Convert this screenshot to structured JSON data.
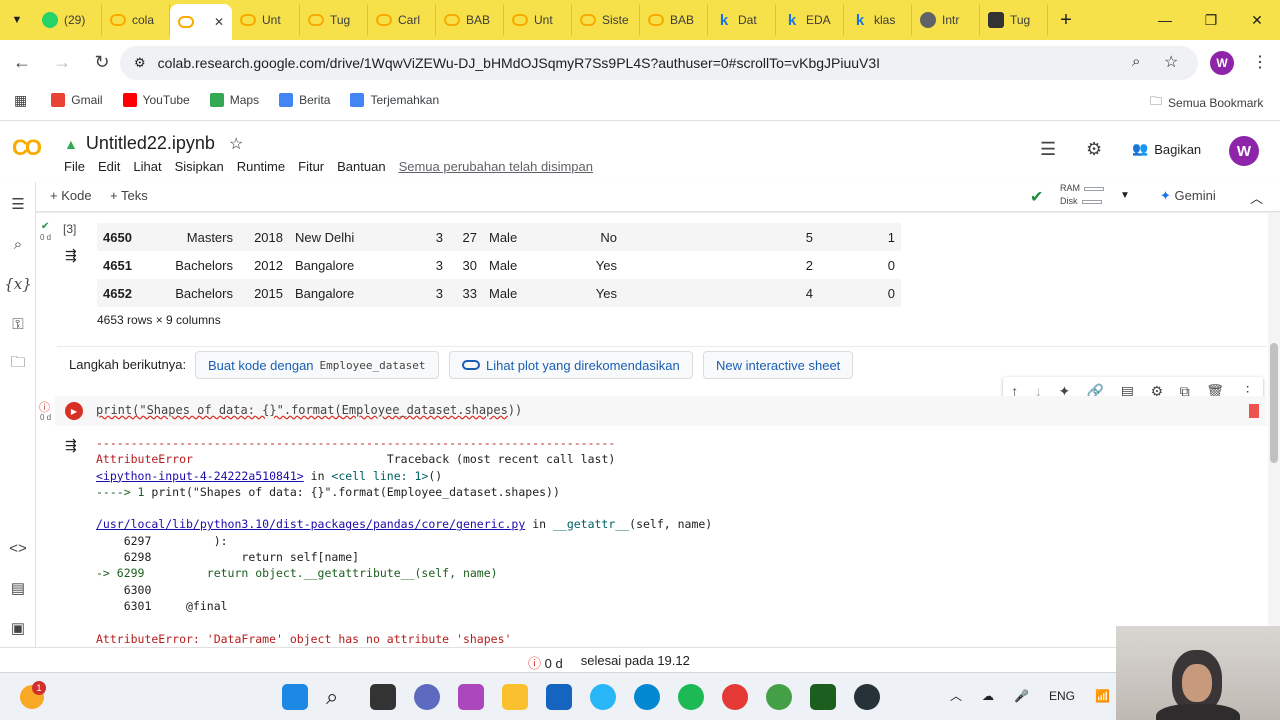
{
  "browser": {
    "tabs": [
      {
        "label": "(29)",
        "icon": "whatsapp-icon"
      },
      {
        "label": "cola",
        "icon": "colab-icon"
      },
      {
        "label": "",
        "icon": "colab-icon",
        "active": true
      },
      {
        "label": "Unt",
        "icon": "colab-icon"
      },
      {
        "label": "Tug",
        "icon": "colab-icon"
      },
      {
        "label": "Carl",
        "icon": "colab-icon"
      },
      {
        "label": "BAB",
        "icon": "colab-icon"
      },
      {
        "label": "Unt",
        "icon": "colab-icon"
      },
      {
        "label": "Siste",
        "icon": "colab-icon"
      },
      {
        "label": "BAB",
        "icon": "colab-icon"
      },
      {
        "label": "Dat",
        "icon": "kaggle-icon"
      },
      {
        "label": "EDA",
        "icon": "kaggle-icon"
      },
      {
        "label": "klas",
        "icon": "kaggle-icon"
      },
      {
        "label": "Intr",
        "icon": "globe-icon"
      },
      {
        "label": "Tug",
        "icon": "slides-icon"
      }
    ],
    "close_glyph": "✕",
    "new_tab_glyph": "+",
    "url": "colab.research.google.com/drive/1WqwViZEWu-DJ_bHMdOJSqmyR7Ss9PL4S?authuser=0#scrollTo=vKbgJPiuuV3I",
    "profile_initial": "W",
    "bookmarks": [
      {
        "label": "Gmail",
        "color": "#ea4335"
      },
      {
        "label": "YouTube",
        "color": "#ff0000"
      },
      {
        "label": "Maps",
        "color": "#34a853"
      },
      {
        "label": "Berita",
        "color": "#4285f4"
      },
      {
        "label": "Terjemahkan",
        "color": "#4285f4"
      }
    ],
    "all_bookmarks": "Semua Bookmark"
  },
  "colab": {
    "logo": "CO",
    "notebook_title": "Untitled22.ipynb",
    "menu": [
      "File",
      "Edit",
      "Lihat",
      "Sisipkan",
      "Runtime",
      "Fitur",
      "Bantuan"
    ],
    "saved_status": "Semua perubahan telah disimpan",
    "share_label": "Bagikan",
    "user_initial": "W",
    "toolbar": {
      "add_code": "+ Kode",
      "add_text": "+ Teks",
      "ram_label": "RAM",
      "disk_label": "Disk",
      "gemini_label": "Gemini"
    }
  },
  "cell1": {
    "exec_count": "[3]",
    "duration": "0 d",
    "rows": [
      {
        "index": "4650",
        "education": "Masters",
        "year": "2018",
        "city": "New Delhi",
        "tier": "3",
        "age": "27",
        "gender": "Male",
        "benched": "No",
        "exp": "5",
        "leave": "1"
      },
      {
        "index": "4651",
        "education": "Bachelors",
        "year": "2012",
        "city": "Bangalore",
        "tier": "3",
        "age": "30",
        "gender": "Male",
        "benched": "Yes",
        "exp": "2",
        "leave": "0"
      },
      {
        "index": "4652",
        "education": "Bachelors",
        "year": "2015",
        "city": "Bangalore",
        "tier": "3",
        "age": "33",
        "gender": "Male",
        "benched": "Yes",
        "exp": "4",
        "leave": "0"
      }
    ],
    "shape_note": "4653 rows × 9 columns"
  },
  "next_steps": {
    "label": "Langkah berikutnya:",
    "chip1_text": "Buat kode dengan",
    "chip1_code": "Employee_dataset",
    "chip2": "Lihat plot yang direkomendasikan",
    "chip3": "New interactive sheet"
  },
  "cell2": {
    "duration": "0 d",
    "code_prefix": "print(\"Shapes of data: {}\".format(",
    "code_arg": "Employee_dataset.shapes",
    "code_suffix": "))"
  },
  "traceback": {
    "dashes": "---------------------------------------------------------------------------",
    "error_name": "AttributeError",
    "traceback_header": "Traceback (most recent call last)",
    "input_link": "<ipython-input-4-24222a510841>",
    "in_cell": " in ",
    "cell_line": "<cell line: 1>",
    "cell_parens": "()",
    "arrow_line": "----> 1 ",
    "arrow_code": "print(\"Shapes of data: {}\".format(Employee_dataset.shapes))",
    "file_link": "/usr/local/lib/python3.10/dist-packages/pandas/core/generic.py",
    "in_func": " in ",
    "func": "__getattr__",
    "func_args": "(self, name)",
    "lines": [
      "    6297         ):",
      "    6298             return self[name]",
      "-> 6299         return object.__getattribute__(self, name)",
      "    6300 ",
      "    6301     @final"
    ],
    "final_error": "AttributeError: 'DataFrame' object has no attribute 'shapes'"
  },
  "statusbar": {
    "error_count": "0 d",
    "completed": "selesai pada 19.12"
  },
  "taskbar": {
    "language": "ENG",
    "notif_badge": "1"
  }
}
